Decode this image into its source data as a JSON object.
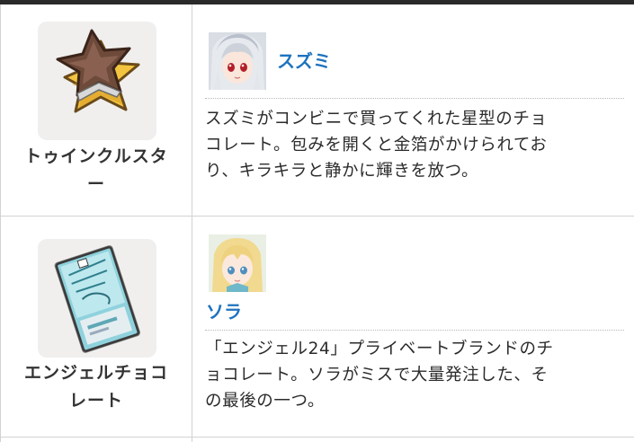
{
  "rows": [
    {
      "item_name_lines": [
        "トゥインクルスタ",
        "ー"
      ],
      "item_icon": "star-chocolate-icon",
      "character": "スズミ",
      "character_avatar": "suzumi-avatar",
      "description_lines": [
        "スズミがコンビニで買ってくれた星型のチョ",
        "コレート。包みを開くと金箔がかけられてお",
        "り、キラキラと静かに輝きを放つ。"
      ]
    },
    {
      "item_name_lines": [
        "エンジェルチョコ",
        "レート"
      ],
      "item_icon": "angel-chocolate-bar-icon",
      "character": "ソラ",
      "character_avatar": "sora-avatar",
      "description_lines": [
        "「エンジェル24」プライベートブランドのチ",
        "ョコレート。ソラがミスで大量発注した、そ",
        "の最後の一つ。"
      ]
    }
  ],
  "colors": {
    "link": "#1e73be",
    "border": "#d2d2d2",
    "top_bar": "#2a2a2a"
  }
}
